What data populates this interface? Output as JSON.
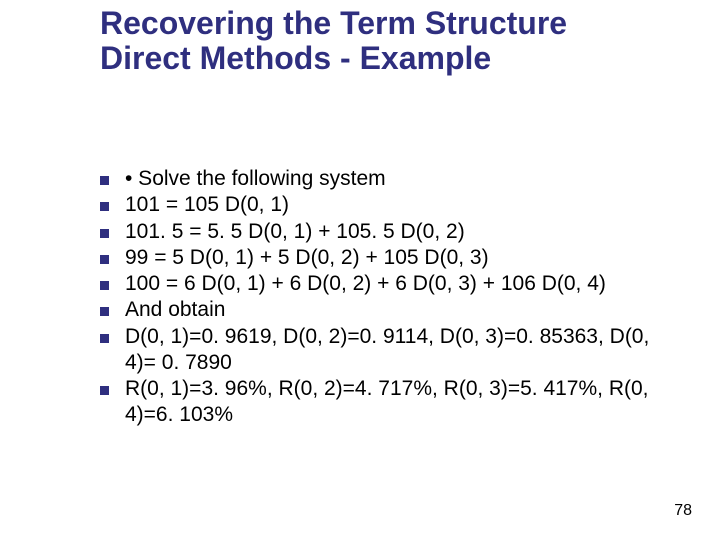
{
  "title_line1": "Recovering the Term Structure",
  "title_line2": "Direct Methods - Example",
  "bullets": [
    "• Solve the following system",
    "101 = 105 D(0, 1)",
    "101. 5 = 5. 5 D(0, 1) + 105. 5 D(0, 2)",
    "99 = 5 D(0, 1) + 5 D(0, 2) + 105 D(0, 3)",
    "100 = 6 D(0, 1) + 6 D(0, 2) + 6 D(0, 3) + 106 D(0, 4)",
    "And obtain",
    "D(0, 1)=0. 9619, D(0, 2)=0. 9114, D(0, 3)=0. 85363, D(0, 4)= 0. 7890",
    "R(0, 1)=3. 96%, R(0, 2)=4. 717%, R(0, 3)=5. 417%, R(0, 4)=6. 103%"
  ],
  "page_number": "78"
}
